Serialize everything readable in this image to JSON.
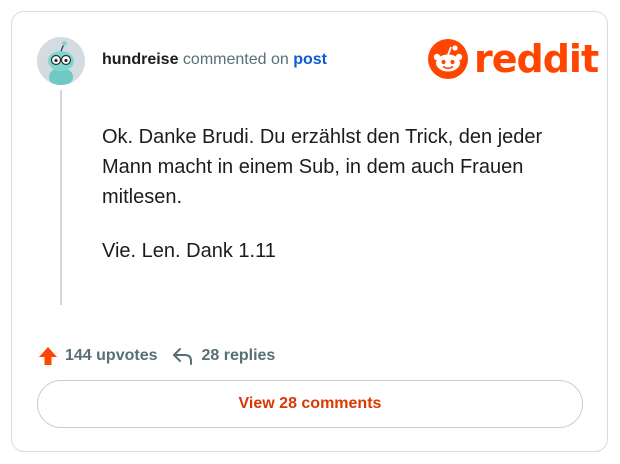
{
  "comment": {
    "username": "hundreise",
    "action_text": "commented on",
    "post_link": "post",
    "paragraphs": [
      "Ok. Danke Brudi. Du erzählst den Trick, den jeder Mann macht in einem Sub, in dem auch Frauen mitlesen.",
      "Vie. Len. Dank 1.11"
    ]
  },
  "brand": {
    "name": "reddit",
    "color": "#ff4500"
  },
  "stats": {
    "upvotes": "144 upvotes",
    "replies": "28 replies"
  },
  "view_comments_label": "View 28 comments",
  "icons": {
    "avatar": "snoo-avatar-icon",
    "logo": "reddit-snoo-icon",
    "upvote": "upvote-arrow-icon",
    "reply": "reply-arrow-icon"
  }
}
